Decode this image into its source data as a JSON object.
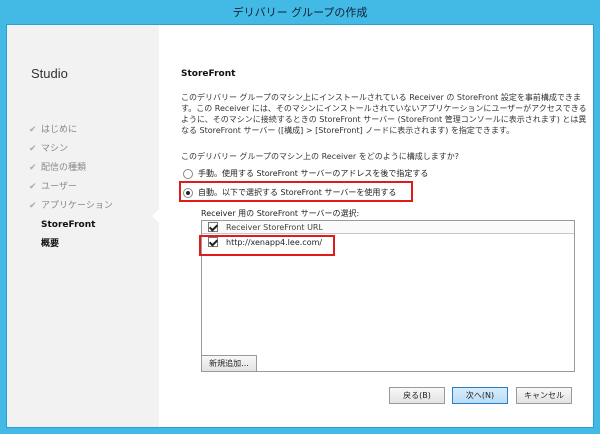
{
  "window": {
    "title": "デリバリー グループの作成"
  },
  "sidebar": {
    "brand": "Studio",
    "steps": [
      {
        "label": "はじめに",
        "state": "done"
      },
      {
        "label": "マシン",
        "state": "done"
      },
      {
        "label": "配信の種類",
        "state": "done"
      },
      {
        "label": "ユーザー",
        "state": "done"
      },
      {
        "label": "アプリケーション",
        "state": "done"
      },
      {
        "label": "StoreFront",
        "state": "current"
      },
      {
        "label": "概要",
        "state": "future"
      }
    ],
    "check_glyph": "✔"
  },
  "main": {
    "title": "StoreFront",
    "description": "このデリバリー グループのマシン上にインストールされている Receiver の StoreFront 設定を事前構成できます。この Receiver には、そのマシンにインストールされていないアプリケーションにユーザーがアクセスできるように、そのマシンに接続するときの StoreFront サーバー (StoreFront 管理コンソールに表示されます) とは異なる StoreFront サーバー ([構成] > [StoreFront] ノードに表示されます) を指定できます。",
    "question": "このデリバリー グループのマシン上の Receiver をどのように構成しますか?",
    "options": [
      {
        "label": "手動。使用する StoreFront サーバーのアドレスを後で指定する",
        "selected": false
      },
      {
        "label": "自動。以下で選択する StoreFront サーバーを使用する",
        "selected": true
      }
    ],
    "list_label": "Receiver 用の StoreFront サーバーの選択:",
    "list_header": "Receiver StoreFront URL",
    "rows": [
      {
        "url": "http://xenapp4.lee.com/",
        "checked": true
      }
    ],
    "add_button": "新規追加...",
    "buttons": {
      "back": "戻る(B)",
      "next": "次へ(N)",
      "cancel": "キャンセル"
    }
  },
  "colors": {
    "title_bar": "#43b9e6",
    "highlight": "#e01b1b",
    "sidebar_bg": "#f2f2f2"
  }
}
